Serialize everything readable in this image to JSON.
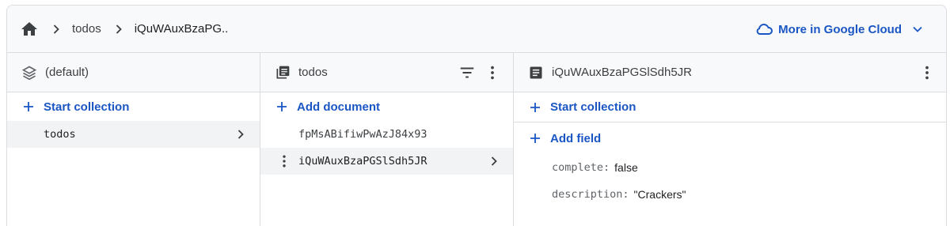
{
  "breadcrumb": {
    "items": [
      "todos",
      "iQuWAuxBzaPG.."
    ]
  },
  "cloud_menu": {
    "label": "More in Google Cloud"
  },
  "columns": {
    "database": {
      "title": "(default)",
      "action": "Start collection",
      "items": [
        {
          "label": "todos",
          "selected": true
        }
      ]
    },
    "collection": {
      "title": "todos",
      "action": "Add document",
      "items": [
        {
          "label": "fpMsABifiwPwAzJ84x93",
          "selected": false
        },
        {
          "label": "iQuWAuxBzaPGSlSdh5JR",
          "selected": true
        }
      ]
    },
    "document": {
      "title": "iQuWAuxBzaPGSlSdh5JR",
      "action_collection": "Start collection",
      "action_field": "Add field",
      "fields": [
        {
          "key": "complete:",
          "value": "false"
        },
        {
          "key": "description:",
          "value": "\"Crackers\""
        }
      ]
    }
  },
  "colors": {
    "accent": "#1a56c4",
    "border": "#dadce0",
    "header_bg": "#f8f9fa",
    "selected_bg": "#f1f3f4"
  },
  "icons": [
    "home-icon",
    "chevron-right-icon",
    "cloud-icon",
    "chevron-down-icon",
    "database-stack-icon",
    "collection-icon",
    "filter-icon",
    "more-vert-icon",
    "document-icon",
    "plus-icon"
  ]
}
